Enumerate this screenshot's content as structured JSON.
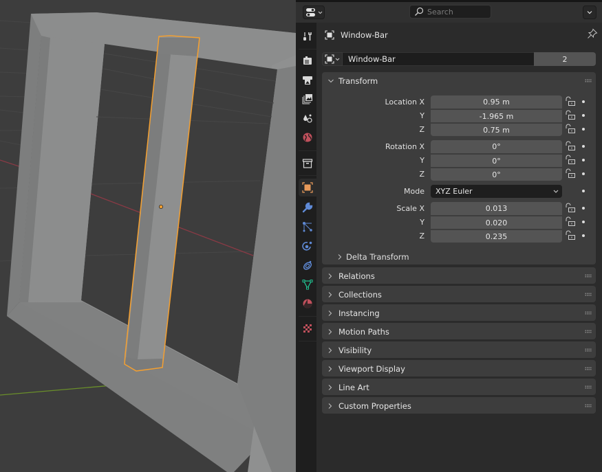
{
  "viewport": {
    "object_name": "Window-Bar",
    "selection_color": "#f5a030",
    "axis_x_color": "#8a3a45",
    "axis_y_color": "#6a8f2a"
  },
  "header": {
    "search_placeholder": "Search",
    "search_value": ""
  },
  "tabs": [
    {
      "name": "tool",
      "icon": "tool-icon",
      "active": false
    },
    {
      "name": "render",
      "icon": "render-icon",
      "active": false
    },
    {
      "name": "output",
      "icon": "output-icon",
      "active": false
    },
    {
      "name": "view-layer",
      "icon": "view-layer-icon",
      "active": false
    },
    {
      "name": "scene",
      "icon": "scene-icon",
      "active": false
    },
    {
      "name": "world",
      "icon": "world-icon",
      "active": false
    },
    {
      "name": "collection",
      "icon": "collection-icon",
      "active": false
    },
    {
      "name": "object",
      "icon": "object-icon",
      "active": true
    },
    {
      "name": "modifiers",
      "icon": "wrench-icon",
      "active": false
    },
    {
      "name": "particles",
      "icon": "particles-icon",
      "active": false
    },
    {
      "name": "physics",
      "icon": "physics-icon",
      "active": false
    },
    {
      "name": "constraints",
      "icon": "constraints-icon",
      "active": false
    },
    {
      "name": "data",
      "icon": "mesh-data-icon",
      "active": false
    },
    {
      "name": "material",
      "icon": "material-icon",
      "active": false
    },
    {
      "name": "texture",
      "icon": "texture-icon",
      "active": false
    }
  ],
  "object": {
    "header_name": "Window-Bar",
    "datablock_name": "Window-Bar",
    "user_count": "2"
  },
  "transform": {
    "title": "Transform",
    "location": {
      "label": "Location X",
      "rows": [
        {
          "axis": "Location X",
          "value": "0.95 m"
        },
        {
          "axis": "Y",
          "value": "-1.965 m"
        },
        {
          "axis": "Z",
          "value": "0.75 m"
        }
      ]
    },
    "rotation": {
      "rows": [
        {
          "axis": "Rotation X",
          "value": "0°"
        },
        {
          "axis": "Y",
          "value": "0°"
        },
        {
          "axis": "Z",
          "value": "0°"
        }
      ]
    },
    "mode": {
      "label": "Mode",
      "value": "XYZ Euler"
    },
    "scale": {
      "rows": [
        {
          "axis": "Scale X",
          "value": "0.013"
        },
        {
          "axis": "Y",
          "value": "0.020"
        },
        {
          "axis": "Z",
          "value": "0.235"
        }
      ]
    },
    "delta_transform": "Delta Transform"
  },
  "panels": [
    {
      "title": "Relations"
    },
    {
      "title": "Collections"
    },
    {
      "title": "Instancing"
    },
    {
      "title": "Motion Paths"
    },
    {
      "title": "Visibility"
    },
    {
      "title": "Viewport Display"
    },
    {
      "title": "Line Art"
    },
    {
      "title": "Custom Properties"
    }
  ]
}
